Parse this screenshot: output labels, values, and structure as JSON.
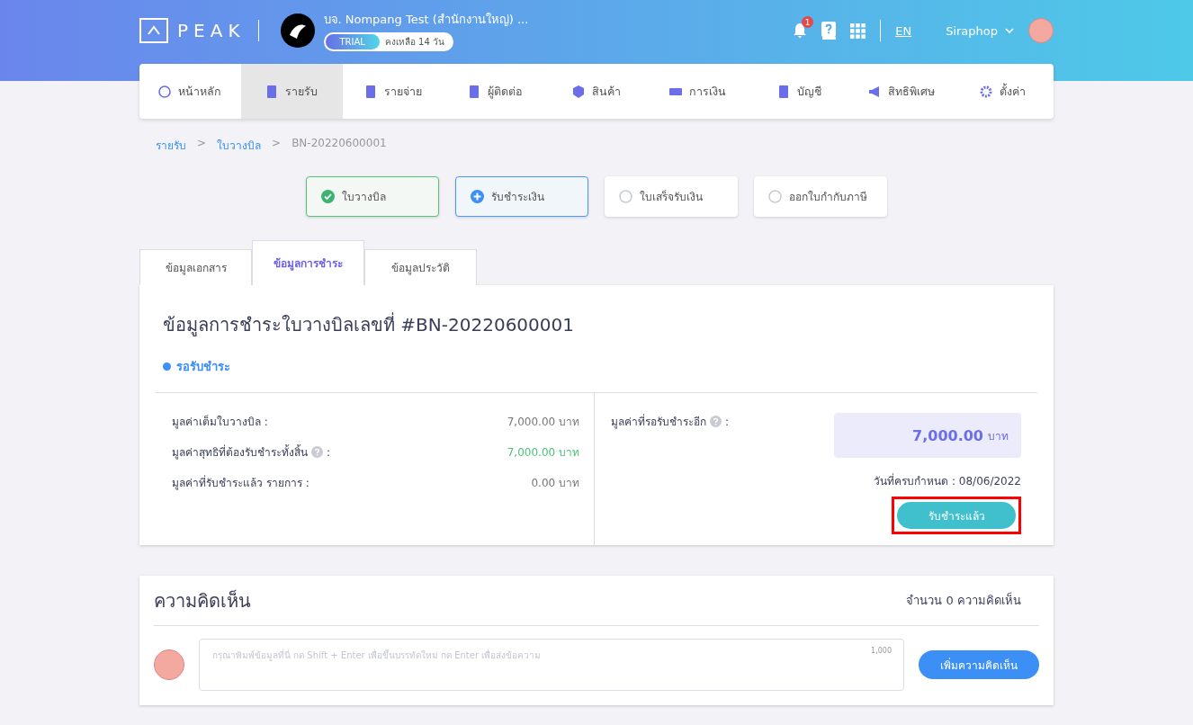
{
  "header": {
    "logo": "PEAK",
    "company": "บจ. Nompang Test (สำนักงานใหญ่) ...",
    "trial_badge": "TRIAL",
    "trial_remaining": "คงเหลือ 14 วัน",
    "notification_count": "1",
    "language": "EN",
    "user": "Siraphop"
  },
  "nav": [
    {
      "label": "หน้าหลัก",
      "selected": false
    },
    {
      "label": "รายรับ",
      "selected": true
    },
    {
      "label": "รายจ่าย",
      "selected": false
    },
    {
      "label": "ผู้ติดต่อ",
      "selected": false
    },
    {
      "label": "สินค้า",
      "selected": false
    },
    {
      "label": "การเงิน",
      "selected": false
    },
    {
      "label": "บัญชี",
      "selected": false
    },
    {
      "label": "สิทธิพิเศษ",
      "selected": false
    },
    {
      "label": "ตั้งค่า",
      "selected": false
    }
  ],
  "breadcrumb": [
    {
      "label": "รายรับ",
      "kind": "link"
    },
    {
      "label": "ใบวางบิล",
      "kind": "link"
    },
    {
      "label": "BN-20220600001",
      "kind": "current"
    }
  ],
  "breadcrumb_separator": ">",
  "steps": [
    {
      "label": "ใบวางบิล",
      "kind": "done"
    },
    {
      "label": "รับชำระเงิน",
      "kind": "current"
    },
    {
      "label": "ใบเสร็จรับเงิน",
      "kind": "pending"
    },
    {
      "label": "ออกใบกำกับภาษี",
      "kind": "pending"
    }
  ],
  "tabs": [
    {
      "label": "ข้อมูลเอกสาร",
      "selected": false
    },
    {
      "label": "ข้อมูลการชำระ",
      "selected": true
    },
    {
      "label": "ข้อมูลประวัติ",
      "selected": false
    }
  ],
  "payment": {
    "title": "ข้อมูลการชำระใบวางบิลเลขที่ #BN-20220600001",
    "status": "รอรับชำระ",
    "rows": [
      {
        "label": "มูลค่าเต็มใบวางบิล :",
        "value": "7,000.00 บาท",
        "help": false,
        "kind": "plain"
      },
      {
        "label": "มูลค่าสุทธิที่ต้องรับชำระทั้งสิ้น",
        "suffix": ":",
        "value": "7,000.00 บาท",
        "help": true,
        "kind": "positive"
      },
      {
        "label": "มูลค่าที่รับชำระแล้ว รายการ :",
        "value": "0.00 บาท",
        "help": false,
        "kind": "plain"
      }
    ],
    "outstanding_label": "มูลค่าที่รอรับชำระอีก",
    "outstanding_suffix": ":",
    "outstanding_amount": "7,000.00",
    "outstanding_unit": "บาท",
    "due_date": "วันที่ครบกำหนด : 08/06/2022",
    "action": "รับชำระแล้ว",
    "action_highlighted": true
  },
  "comments": {
    "title": "ความคิดเห็น",
    "count": "จำนวน 0 ความคิดเห็น",
    "placeholder": "กรุณาพิมพ์ข้อมูลที่นี่ กด Shift + Enter เพื่อขึ้นบรรทัดใหม่ กด Enter เพื่อส่งข้อความ",
    "char_limit": "1,000",
    "button": "เพิ่มความคิดเห็น"
  }
}
